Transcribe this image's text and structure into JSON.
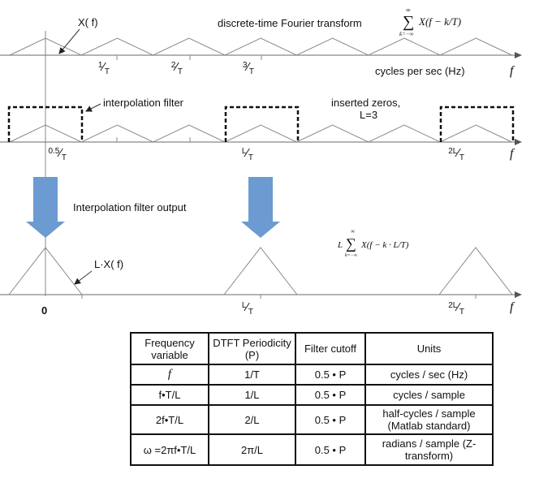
{
  "top_panel": {
    "signal_label": "X( f)",
    "title": "discrete-time Fourier transform",
    "formula": {
      "sum": "∑",
      "upper": "∞",
      "lower": "k=−∞",
      "body": "X(f − k/T)"
    },
    "ticks": [
      {
        "num": "1",
        "den": "T"
      },
      {
        "num": "2",
        "den": "T"
      },
      {
        "num": "3",
        "den": "T"
      }
    ],
    "axis_units": "cycles per sec (Hz)",
    "axis_symbol": "f"
  },
  "middle_panel": {
    "filter_label": "interpolation filter",
    "zeros_label": "inserted zeros,",
    "zeros_value": "L=3",
    "ticks": [
      {
        "num": "0.5",
        "den": "T"
      },
      {
        "num": "L",
        "den": "T"
      },
      {
        "num": "2L",
        "den": "T"
      }
    ],
    "axis_symbol": "f"
  },
  "bottom_panel": {
    "output_label": "Interpolation filter output",
    "signal_label": "L·X( f)",
    "formula": {
      "prefix": "L",
      "sum": "∑",
      "upper": "∞",
      "lower": "k=−∞",
      "body": "X(f − k · L/T)"
    },
    "zero_label": "0",
    "ticks": [
      {
        "num": "L",
        "den": "T"
      },
      {
        "num": "2L",
        "den": "T"
      }
    ],
    "axis_symbol": "f"
  },
  "colors": {
    "arrow": "#6b9bd1",
    "line": "#888888"
  },
  "table": {
    "headers": [
      "Frequency variable",
      "DTFT Periodicity (P)",
      "Filter cutoff",
      "Units"
    ],
    "rows": [
      [
        "f",
        "1/T",
        "0.5 • P",
        "cycles / sec (Hz)"
      ],
      [
        "f•T/L",
        "1/L",
        "0.5 • P",
        "cycles / sample"
      ],
      [
        "2f•T/L",
        "2/L",
        "0.5 • P",
        "half-cycles / sample (Matlab standard)"
      ],
      [
        "ω =2πf•T/L",
        "2π/L",
        "0.5 • P",
        "radians / sample (Z-transform)"
      ]
    ]
  }
}
